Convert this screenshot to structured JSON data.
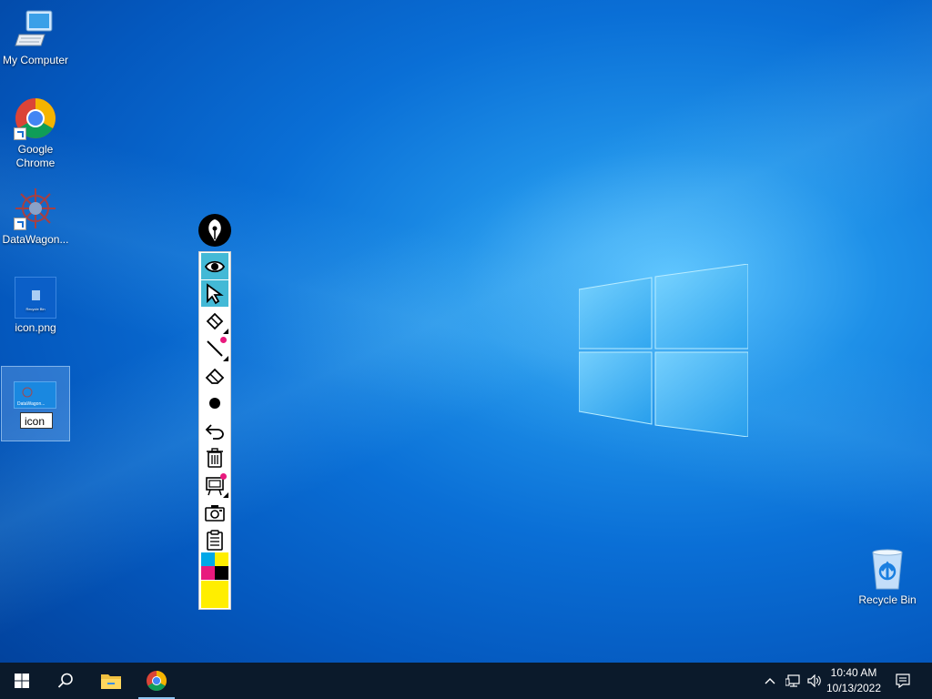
{
  "desktop": {
    "icons": [
      {
        "label": "My Computer"
      },
      {
        "label": "Google Chrome"
      },
      {
        "label": "DataWagon..."
      },
      {
        "label": "icon.png"
      },
      {
        "label": "Recycle Bin"
      }
    ],
    "selected_icon": {
      "thumb_text": "DataWagon...",
      "rename_value": "icon"
    },
    "icon_png_thumb_text": "Recycle Bin"
  },
  "annotation_toolbar": {
    "tools": [
      {
        "name": "eye-icon",
        "active": true
      },
      {
        "name": "cursor-arrow-icon",
        "active": true
      },
      {
        "name": "highlighter-icon",
        "active": false
      },
      {
        "name": "pen-line-icon",
        "active": false
      },
      {
        "name": "eraser-icon",
        "active": false
      },
      {
        "name": "dot-icon",
        "active": false
      },
      {
        "name": "undo-icon",
        "active": false
      },
      {
        "name": "trash-icon",
        "active": false
      },
      {
        "name": "whiteboard-icon",
        "active": false
      },
      {
        "name": "camera-icon",
        "active": false
      },
      {
        "name": "clipboard-icon",
        "active": false
      }
    ],
    "palette": [
      "#00a8e8",
      "#ffee00",
      "#e8197d",
      "#000000",
      "#ffee00"
    ],
    "accent_color": "#43b9d6",
    "indicator_color": "#e8197d"
  },
  "taskbar": {
    "buttons": [
      "start-icon",
      "search-icon",
      "file-explorer-icon",
      "chrome-icon"
    ],
    "tray_icons": [
      "chevron-up-icon",
      "network-icon",
      "volume-icon",
      "notifications-icon"
    ],
    "clock": {
      "time": "10:40 AM",
      "date": "10/13/2022"
    }
  }
}
